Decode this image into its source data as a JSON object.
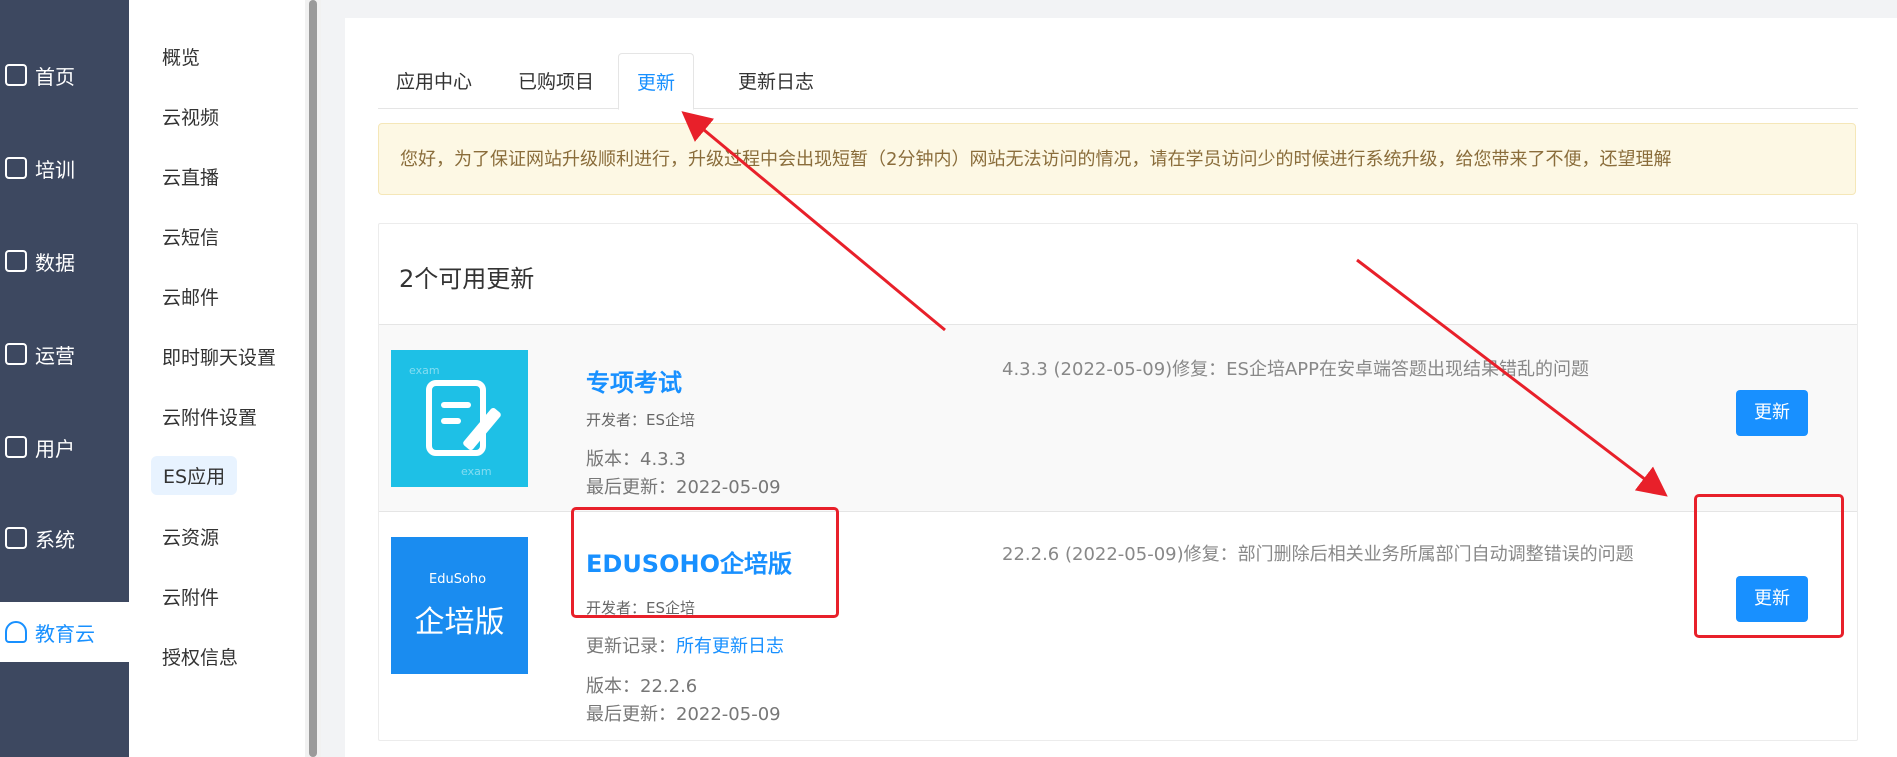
{
  "nav": {
    "items": [
      {
        "label": "首页",
        "icon": "chart-icon"
      },
      {
        "label": "培训",
        "icon": "book-icon"
      },
      {
        "label": "数据",
        "icon": "bar-chart-icon"
      },
      {
        "label": "运营",
        "icon": "command-icon"
      },
      {
        "label": "用户",
        "icon": "user-icon"
      },
      {
        "label": "系统",
        "icon": "gear-icon"
      },
      {
        "label": "教育云",
        "icon": "cloud-icon"
      }
    ]
  },
  "subnav": {
    "items": [
      "概览",
      "云视频",
      "云直播",
      "云短信",
      "云邮件",
      "即时聊天设置",
      "云附件设置",
      "ES应用",
      "云资源",
      "云附件",
      "授权信息"
    ]
  },
  "tabs": [
    "应用中心",
    "已购项目",
    "更新",
    "更新日志"
  ],
  "alert": "您好，为了保证网站升级顺利进行，升级过程中会出现短暂（2分钟内）网站无法访问的情况，请在学员访问少的时候进行系统升级，给您带来了不便，还望理解",
  "panel": {
    "title": "2个可用更新",
    "apps": [
      {
        "name": "专项考试",
        "developer": "开发者：ES企培",
        "version": "版本：4.3.3",
        "updated": "最后更新：2022-05-09",
        "changelog": "4.3.3 (2022-05-09)修复：ES企培APP在安卓端答题出现结果错乱的问题",
        "button": "更新",
        "thumb_watermark": "exam"
      },
      {
        "name": "EDUSOHO企培版",
        "developer": "开发者：ES企培",
        "record_label": "更新记录：",
        "record_link": "所有更新日志",
        "version": "版本：22.2.6",
        "updated": "最后更新：2022-05-09",
        "changelog": "22.2.6 (2022-05-09)修复：部门删除后相关业务所属部门自动调整错误的问题",
        "button": "更新",
        "thumb_brand": "EduSoho",
        "thumb_text": "企培版"
      }
    ]
  },
  "colors": {
    "accent": "#1890ff",
    "nav_bg": "#3d4860",
    "annotation": "#e8202a"
  }
}
